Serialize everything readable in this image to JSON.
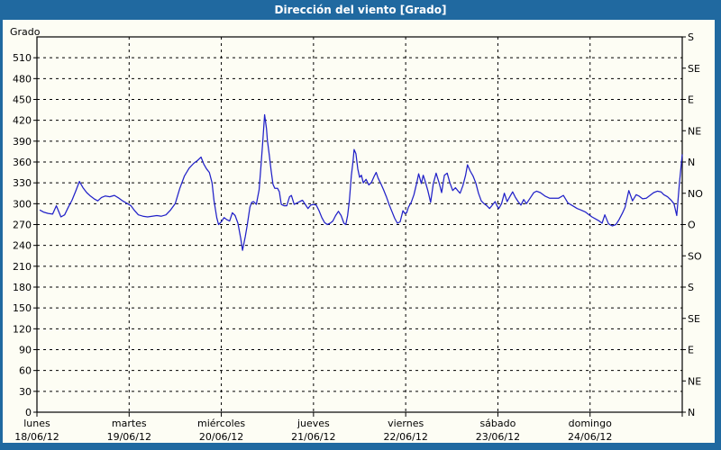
{
  "title": "Dirección del viento [Grado]",
  "colors": {
    "frame_blue": "#2069a0",
    "title_text": "#ffffff",
    "panel_background": "#fdfdf4",
    "line_blue": "#2121c8",
    "grid_black": "#000000"
  },
  "y_axis": {
    "label": "Grado",
    "min": 0,
    "max": 540,
    "tick_step": 30,
    "tick_labels": [
      "0",
      "30",
      "60",
      "90",
      "120",
      "150",
      "180",
      "210",
      "240",
      "270",
      "300",
      "330",
      "360",
      "390",
      "420",
      "450",
      "480",
      "510"
    ]
  },
  "right_axis": {
    "labels": [
      {
        "deg": 540,
        "text": "S"
      },
      {
        "deg": 495,
        "text": "SE"
      },
      {
        "deg": 450,
        "text": "E"
      },
      {
        "deg": 405,
        "text": "NE"
      },
      {
        "deg": 360,
        "text": "N"
      },
      {
        "deg": 315,
        "text": "NO"
      },
      {
        "deg": 270,
        "text": "O"
      },
      {
        "deg": 225,
        "text": "SO"
      },
      {
        "deg": 180,
        "text": "S"
      },
      {
        "deg": 135,
        "text": "SE"
      },
      {
        "deg": 90,
        "text": "E"
      },
      {
        "deg": 45,
        "text": "NE"
      },
      {
        "deg": 0,
        "text": "N"
      }
    ]
  },
  "x_axis": {
    "days": [
      {
        "name": "lunes",
        "date": "18/06/12"
      },
      {
        "name": "martes",
        "date": "19/06/12"
      },
      {
        "name": "miércoles",
        "date": "20/06/12"
      },
      {
        "name": "jueves",
        "date": "21/06/12"
      },
      {
        "name": "viernes",
        "date": "22/06/12"
      },
      {
        "name": "sábado",
        "date": "23/06/12"
      },
      {
        "name": "domingo",
        "date": "24/06/12"
      }
    ]
  },
  "chart_data": {
    "type": "line",
    "title": "Dirección del viento [Grado]",
    "ylabel": "Grado",
    "ylim": [
      0,
      540
    ],
    "y_tick_step": 30,
    "xlim": [
      0,
      7
    ],
    "x_unit": "days (0 = lunes 18/06/12 00:00, 7 = domingo 24/06/12 24:00)",
    "grid": "dashed horizontal every 30 deg, dashed vertical at each day",
    "legend": "none",
    "right_axis_compass_every_45deg": [
      "N",
      "NE",
      "E",
      "SE",
      "S",
      "SO",
      "O",
      "NO",
      "N",
      "NE",
      "E",
      "SE",
      "S"
    ],
    "series": [
      {
        "name": "Dirección del viento",
        "color": "#2121c8",
        "points": [
          [
            0.03,
            291
          ],
          [
            0.07,
            288
          ],
          [
            0.12,
            286
          ],
          [
            0.17,
            285
          ],
          [
            0.21,
            297
          ],
          [
            0.26,
            281
          ],
          [
            0.3,
            284
          ],
          [
            0.34,
            295
          ],
          [
            0.38,
            305
          ],
          [
            0.42,
            318
          ],
          [
            0.46,
            332
          ],
          [
            0.5,
            323
          ],
          [
            0.54,
            316
          ],
          [
            0.58,
            311
          ],
          [
            0.62,
            307
          ],
          [
            0.66,
            304
          ],
          [
            0.7,
            309
          ],
          [
            0.74,
            311
          ],
          [
            0.79,
            310
          ],
          [
            0.84,
            312
          ],
          [
            0.89,
            308
          ],
          [
            0.93,
            304
          ],
          [
            0.97,
            301
          ],
          [
            1.02,
            297
          ],
          [
            1.06,
            290
          ],
          [
            1.1,
            284
          ],
          [
            1.15,
            282
          ],
          [
            1.2,
            281
          ],
          [
            1.25,
            282
          ],
          [
            1.3,
            283
          ],
          [
            1.35,
            282
          ],
          [
            1.4,
            284
          ],
          [
            1.45,
            291
          ],
          [
            1.5,
            300
          ],
          [
            1.55,
            322
          ],
          [
            1.6,
            340
          ],
          [
            1.65,
            351
          ],
          [
            1.7,
            358
          ],
          [
            1.74,
            362
          ],
          [
            1.78,
            367
          ],
          [
            1.81,
            357
          ],
          [
            1.84,
            350
          ],
          [
            1.87,
            345
          ],
          [
            1.9,
            330
          ],
          [
            1.92,
            305
          ],
          [
            1.95,
            280
          ],
          [
            1.97,
            270
          ],
          [
            2.0,
            274
          ],
          [
            2.03,
            280
          ],
          [
            2.06,
            277
          ],
          [
            2.09,
            275
          ],
          [
            2.12,
            287
          ],
          [
            2.15,
            283
          ],
          [
            2.18,
            272
          ],
          [
            2.21,
            250
          ],
          [
            2.23,
            233
          ],
          [
            2.26,
            253
          ],
          [
            2.28,
            268
          ],
          [
            2.31,
            295
          ],
          [
            2.33,
            302
          ],
          [
            2.35,
            303
          ],
          [
            2.38,
            299
          ],
          [
            2.41,
            320
          ],
          [
            2.43,
            355
          ],
          [
            2.45,
            390
          ],
          [
            2.47,
            428
          ],
          [
            2.49,
            408
          ],
          [
            2.5,
            391
          ],
          [
            2.52,
            370
          ],
          [
            2.54,
            348
          ],
          [
            2.56,
            328
          ],
          [
            2.58,
            322
          ],
          [
            2.61,
            322
          ],
          [
            2.63,
            317
          ],
          [
            2.65,
            299
          ],
          [
            2.68,
            297
          ],
          [
            2.71,
            297
          ],
          [
            2.74,
            310
          ],
          [
            2.76,
            312
          ],
          [
            2.79,
            299
          ],
          [
            2.82,
            301
          ],
          [
            2.85,
            303
          ],
          [
            2.88,
            305
          ],
          [
            2.91,
            299
          ],
          [
            2.94,
            293
          ],
          [
            2.97,
            298
          ],
          [
            3.0,
            299
          ],
          [
            3.03,
            298
          ],
          [
            3.06,
            290
          ],
          [
            3.09,
            280
          ],
          [
            3.12,
            273
          ],
          [
            3.15,
            270
          ],
          [
            3.18,
            272
          ],
          [
            3.21,
            275
          ],
          [
            3.24,
            283
          ],
          [
            3.27,
            289
          ],
          [
            3.3,
            283
          ],
          [
            3.33,
            272
          ],
          [
            3.35,
            270
          ],
          [
            3.37,
            283
          ],
          [
            3.39,
            305
          ],
          [
            3.41,
            340
          ],
          [
            3.43,
            362
          ],
          [
            3.44,
            378
          ],
          [
            3.46,
            372
          ],
          [
            3.48,
            350
          ],
          [
            3.5,
            338
          ],
          [
            3.52,
            341
          ],
          [
            3.54,
            330
          ],
          [
            3.57,
            335
          ],
          [
            3.6,
            327
          ],
          [
            3.63,
            331
          ],
          [
            3.66,
            340
          ],
          [
            3.68,
            345
          ],
          [
            3.7,
            337
          ],
          [
            3.73,
            329
          ],
          [
            3.76,
            320
          ],
          [
            3.79,
            310
          ],
          [
            3.82,
            299
          ],
          [
            3.85,
            289
          ],
          [
            3.88,
            279
          ],
          [
            3.91,
            272
          ],
          [
            3.94,
            274
          ],
          [
            3.97,
            290
          ],
          [
            3.99,
            286
          ],
          [
            4.01,
            287
          ],
          [
            4.03,
            295
          ],
          [
            4.06,
            302
          ],
          [
            4.09,
            313
          ],
          [
            4.12,
            330
          ],
          [
            4.14,
            343
          ],
          [
            4.17,
            329
          ],
          [
            4.19,
            341
          ],
          [
            4.21,
            333
          ],
          [
            4.24,
            319
          ],
          [
            4.27,
            302
          ],
          [
            4.3,
            329
          ],
          [
            4.33,
            344
          ],
          [
            4.36,
            331
          ],
          [
            4.39,
            316
          ],
          [
            4.42,
            341
          ],
          [
            4.45,
            344
          ],
          [
            4.48,
            330
          ],
          [
            4.51,
            319
          ],
          [
            4.54,
            323
          ],
          [
            4.57,
            318
          ],
          [
            4.59,
            315
          ],
          [
            4.62,
            326
          ],
          [
            4.65,
            341
          ],
          [
            4.67,
            356
          ],
          [
            4.7,
            347
          ],
          [
            4.73,
            340
          ],
          [
            4.76,
            330
          ],
          [
            4.79,
            315
          ],
          [
            4.82,
            304
          ],
          [
            4.85,
            300
          ],
          [
            4.88,
            297
          ],
          [
            4.91,
            293
          ],
          [
            4.94,
            298
          ],
          [
            4.97,
            303
          ],
          [
            4.99,
            297
          ],
          [
            5.01,
            293
          ],
          [
            5.04,
            300
          ],
          [
            5.07,
            315
          ],
          [
            5.1,
            303
          ],
          [
            5.13,
            310
          ],
          [
            5.16,
            317
          ],
          [
            5.19,
            309
          ],
          [
            5.22,
            303
          ],
          [
            5.25,
            298
          ],
          [
            5.28,
            306
          ],
          [
            5.31,
            300
          ],
          [
            5.35,
            308
          ],
          [
            5.39,
            316
          ],
          [
            5.42,
            318
          ],
          [
            5.46,
            316
          ],
          [
            5.51,
            311
          ],
          [
            5.56,
            308
          ],
          [
            5.61,
            308
          ],
          [
            5.66,
            308
          ],
          [
            5.71,
            312
          ],
          [
            5.76,
            301
          ],
          [
            5.81,
            297
          ],
          [
            5.86,
            293
          ],
          [
            5.9,
            291
          ],
          [
            5.95,
            288
          ],
          [
            5.99,
            284
          ],
          [
            6.02,
            281
          ],
          [
            6.06,
            278
          ],
          [
            6.1,
            275
          ],
          [
            6.13,
            272
          ],
          [
            6.16,
            284
          ],
          [
            6.2,
            271
          ],
          [
            6.24,
            268
          ],
          [
            6.28,
            270
          ],
          [
            6.31,
            276
          ],
          [
            6.35,
            286
          ],
          [
            6.38,
            295
          ],
          [
            6.42,
            319
          ],
          [
            6.46,
            304
          ],
          [
            6.5,
            313
          ],
          [
            6.53,
            311
          ],
          [
            6.57,
            307
          ],
          [
            6.61,
            308
          ],
          [
            6.65,
            312
          ],
          [
            6.69,
            316
          ],
          [
            6.73,
            318
          ],
          [
            6.77,
            317
          ],
          [
            6.8,
            313
          ],
          [
            6.84,
            310
          ],
          [
            6.88,
            305
          ],
          [
            6.91,
            300
          ],
          [
            6.94,
            283
          ],
          [
            6.97,
            330
          ],
          [
            7.0,
            371
          ]
        ]
      }
    ]
  }
}
